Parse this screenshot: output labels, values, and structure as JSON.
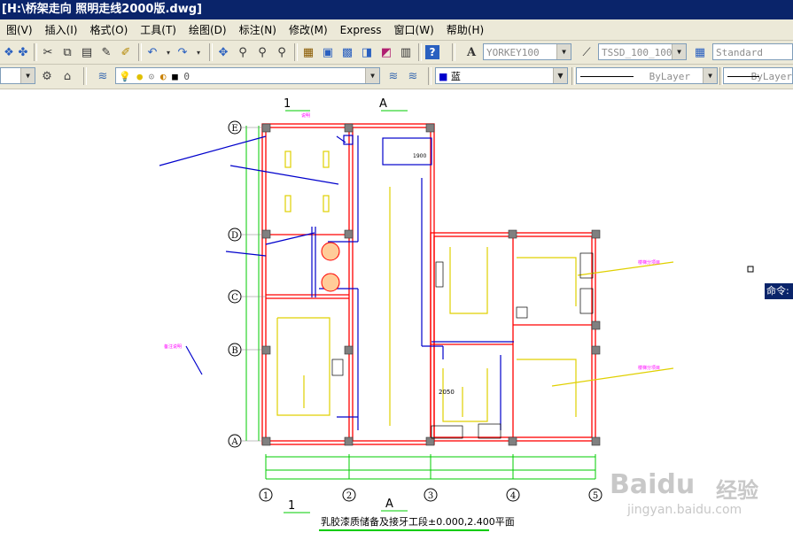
{
  "window": {
    "title": "[H:\\桥架走向 照明走线2000版.dwg]"
  },
  "menu": [
    "图(V)",
    "插入(I)",
    "格式(O)",
    "工具(T)",
    "绘图(D)",
    "标注(N)",
    "修改(M)",
    "Express",
    "窗口(W)",
    "帮助(H)"
  ],
  "toolbar": {
    "text_style": "YORKEY100",
    "dim_style": "TSSD_100_100",
    "table_style": "Standard",
    "layer_value": "0",
    "color_value": "蓝",
    "linetype_value": "ByLayer",
    "lineweight_value": "ByLayer"
  },
  "command_tag": "命令:",
  "drawing": {
    "title": "乳胶漆质储备及接牙工段±0.000,2.400平面",
    "section_labels": [
      "1",
      "A",
      "A",
      "1"
    ],
    "row_axes": [
      "E",
      "D",
      "C",
      "B",
      "A"
    ],
    "column_axes": [
      "1",
      "2",
      "3",
      "4",
      "5"
    ],
    "dimension_2050": "2050",
    "dimension_1900": "1900",
    "colors": {
      "wall": "#ff0000",
      "dimension": "#00cc00",
      "light": "#ffff00",
      "note": "#ff00ff",
      "cable": "#0000cc",
      "axis_gray": "#808080"
    }
  },
  "watermark": {
    "brand": "Baidu",
    "brand_cn": "经验",
    "url": "jingyan.baidu.com"
  }
}
